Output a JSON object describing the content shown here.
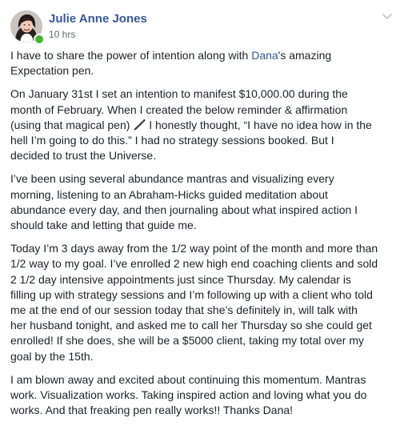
{
  "post": {
    "author": "Julie Anne Jones",
    "timestamp": "10 hrs",
    "paragraphs": [
      {
        "lines": [
          [
            "I have to share the power of intention along with ",
            {
              "link": "Dana"
            },
            "'s amazing"
          ],
          [
            "Expectation pen."
          ]
        ]
      },
      {
        "lines": [
          [
            "On January 31st I set an intention to manifest $10,000.00 during the"
          ],
          [
            "month of February. When I created the below reminder & affirmation"
          ],
          [
            "(using that magical pen) ",
            {
              "icon": "pen-icon"
            },
            " I honestly thought, “I have no idea how in the"
          ],
          [
            "hell I’m going to do this.” I had no strategy sessions booked. But I"
          ],
          [
            "decided to trust the Universe."
          ]
        ]
      },
      {
        "lines": [
          [
            "I’ve been using several abundance mantras and visualizing every"
          ],
          [
            "morning, listening to an Abraham-Hicks guided meditation about"
          ],
          [
            "abundance every day, and then journaling about what inspired action I"
          ],
          [
            "should take and letting that guide me."
          ]
        ]
      },
      {
        "lines": [
          [
            "Today I’m 3 days away from the 1/2 way point of the month and more than"
          ],
          [
            "1/2 way to my goal. I’ve enrolled 2 new high end coaching clients and sold"
          ],
          [
            "2 1/2 day intensive appointments just since Thursday. My calendar is"
          ],
          [
            "filling up with strategy sessions and I’m following up with a client who told"
          ],
          [
            "me at the end of our session today that she’s definitely in, will talk with"
          ],
          [
            "her husband tonight, and asked me to call her Thursday so she could get"
          ],
          [
            "enrolled! If she does, she will be a $5000 client, taking my total over my"
          ],
          [
            "goal by the 15th."
          ]
        ]
      },
      {
        "lines": [
          [
            "I am blown away and excited about continuing this momentum. Mantras"
          ],
          [
            "work. Visualization works. Taking inspired action and loving what you do"
          ],
          [
            "works. And that freaking pen really works!! Thanks Dana!"
          ]
        ]
      }
    ]
  },
  "colors": {
    "author_link": "#365899",
    "body_text": "#1d2129",
    "timestamp": "#606770",
    "online_dot": "#42b72a"
  },
  "icons": {
    "avatar": "profile-photo",
    "online": "online-status-dot",
    "options": "chevron-down-icon",
    "inline": "pen-icon"
  }
}
